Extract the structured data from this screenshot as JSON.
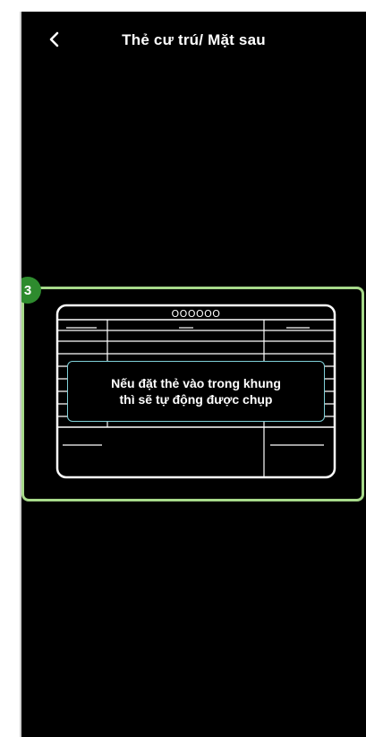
{
  "header": {
    "title": "Thẻ cư trú/ Mặt sau",
    "back_icon": "chevron-left-icon"
  },
  "step_badge": "3",
  "card": {
    "number_placeholder": "OOOOOO"
  },
  "hint": {
    "line1": "Nếu đặt thẻ vào trong khung",
    "line2": "thì sẽ tự động được chụp"
  },
  "colors": {
    "background": "#000000",
    "highlight_border": "#a7d98a",
    "badge": "#2e8b2e",
    "hint_border": "#7fd0d8",
    "card_outline": "#ffffff"
  }
}
